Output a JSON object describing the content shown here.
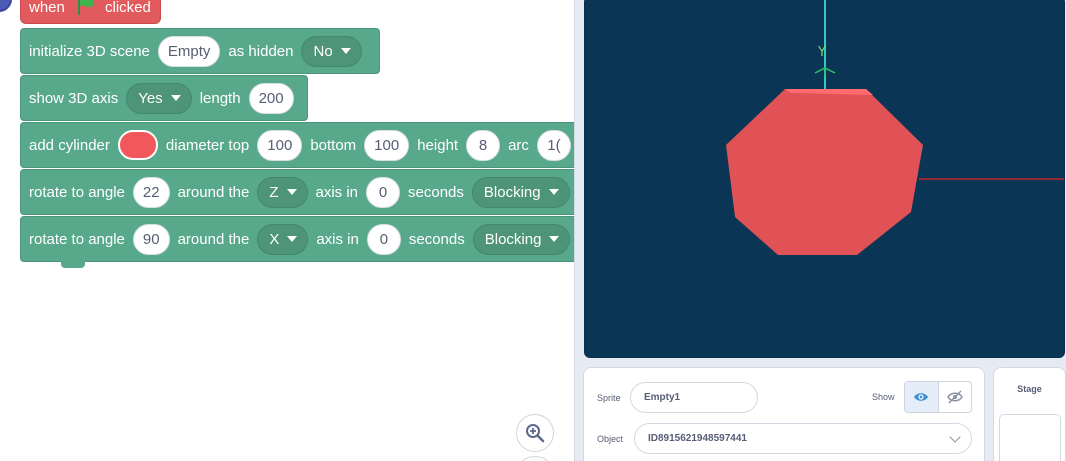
{
  "colors": {
    "event_block": "#e15a5d",
    "block": "#58a98b",
    "stage_bg": "#0b3554",
    "cylinder": "#e05256",
    "axis_y": "#36c6c8",
    "axis_x": "#c0242e",
    "flag": "#3fb34f"
  },
  "script": {
    "hat": {
      "when": "when",
      "clicked": "clicked",
      "icon": "green-flag-icon"
    },
    "blocks": [
      {
        "text": "initialize 3D scene",
        "scene": "Empty",
        "as_hidden": "as hidden",
        "hidden_value": "No"
      },
      {
        "text": "show 3D axis",
        "axis_value": "Yes",
        "length_label": "length",
        "length": "200"
      },
      {
        "text": "add cylinder",
        "color": "#f2575c",
        "diameter_top_label": "diameter top",
        "diameter_top": "100",
        "bottom_label": "bottom",
        "bottom": "100",
        "height_label": "height",
        "height": "8",
        "arc_label": "arc",
        "arc": "1("
      },
      {
        "text": "rotate to angle",
        "angle": "22",
        "around": "around the",
        "axis": "Z",
        "axis_in": "axis in",
        "time": "0",
        "seconds": "seconds",
        "mode": "Blocking"
      },
      {
        "text": "rotate to angle",
        "angle": "90",
        "around": "around the",
        "axis": "X",
        "axis_in": "axis in",
        "time": "0",
        "seconds": "seconds",
        "mode": "Blocking"
      }
    ]
  },
  "zoom": {
    "icon": "zoom-in-icon"
  },
  "stage": {
    "axis_y_label": "Y"
  },
  "sprite_panel": {
    "sprite_label": "Sprite",
    "sprite_name": "Empty1",
    "show_label": "Show",
    "show_icons": [
      "eye-icon",
      "eye-slash-icon"
    ],
    "object_label": "Object",
    "object_value": "ID8915621948597441"
  },
  "stage_tab": {
    "label": "Stage"
  }
}
